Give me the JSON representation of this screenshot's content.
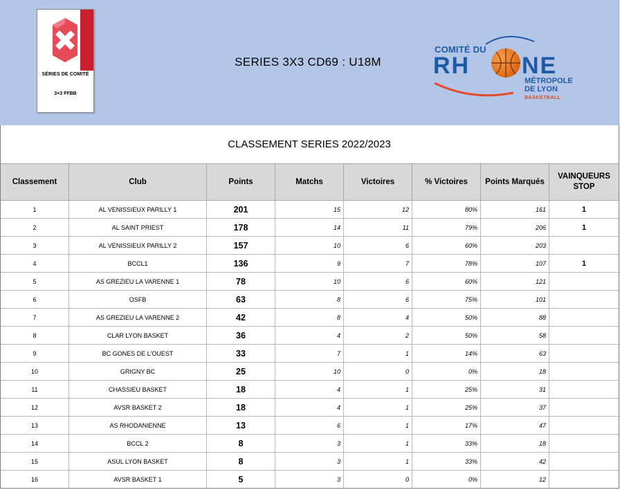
{
  "header": {
    "title": "SERIES 3X3 CD69 : U18M",
    "left_logo": {
      "icon": "3x3-series-logo",
      "line1": "SÉRIES DE COMITÉ",
      "line2": "3×3 FFBB"
    },
    "right_logo": {
      "line1": "COMITÉ DU",
      "rh": "RH",
      "ne": "NE",
      "line3": "MÉTROPOLE",
      "line4": "DE LYON",
      "line5": "BASKETBALL"
    }
  },
  "subtitle": "CLASSEMENT SERIES 2022/2023",
  "colors": {
    "header_bg": "#b4c6e7",
    "table_header_bg": "#d9d9d9",
    "logo_blue": "#1f5aa6",
    "logo_orange": "#e2701c"
  },
  "table": {
    "columns": [
      "Classement",
      "Club",
      "Points",
      "Matchs",
      "Victoires",
      "% Victoires",
      "Points Marqués",
      "VAINQUEURS STOP"
    ],
    "rows": [
      [
        "1",
        "AL VENISSIEUX PARILLY 1",
        "201",
        "15",
        "12",
        "80%",
        "161",
        "1"
      ],
      [
        "2",
        "AL SAINT PRIEST",
        "178",
        "14",
        "11",
        "79%",
        "206",
        "1"
      ],
      [
        "3",
        "AL VENISSIEUX PARILLY 2",
        "157",
        "10",
        "6",
        "60%",
        "203",
        ""
      ],
      [
        "4",
        "BCCL1",
        "136",
        "9",
        "7",
        "78%",
        "107",
        "1"
      ],
      [
        "5",
        "AS GREZIEU LA VARENNE 1",
        "78",
        "10",
        "6",
        "60%",
        "121",
        ""
      ],
      [
        "6",
        "OSFB",
        "63",
        "8",
        "6",
        "75%",
        "101",
        ""
      ],
      [
        "7",
        "AS GREZIEU LA VARENNE 2",
        "42",
        "8",
        "4",
        "50%",
        "88",
        ""
      ],
      [
        "8",
        "CLAR LYON BASKET",
        "36",
        "4",
        "2",
        "50%",
        "58",
        ""
      ],
      [
        "9",
        "BC GONES DE L'OUEST",
        "33",
        "7",
        "1",
        "14%",
        "63",
        ""
      ],
      [
        "10",
        "GRIGNY BC",
        "25",
        "10",
        "0",
        "0%",
        "18",
        ""
      ],
      [
        "11",
        "CHASSIEU BASKET",
        "18",
        "4",
        "1",
        "25%",
        "31",
        ""
      ],
      [
        "12",
        "AVSR BASKET 2",
        "18",
        "4",
        "1",
        "25%",
        "37",
        ""
      ],
      [
        "13",
        "AS RHODANIENNE",
        "13",
        "6",
        "1",
        "17%",
        "47",
        ""
      ],
      [
        "14",
        "BCCL 2",
        "8",
        "3",
        "1",
        "33%",
        "18",
        ""
      ],
      [
        "15",
        "ASUL LYON BASKET",
        "8",
        "3",
        "1",
        "33%",
        "42",
        ""
      ],
      [
        "16",
        "AVSR BASKET 1",
        "5",
        "3",
        "0",
        "0%",
        "12",
        ""
      ]
    ]
  }
}
